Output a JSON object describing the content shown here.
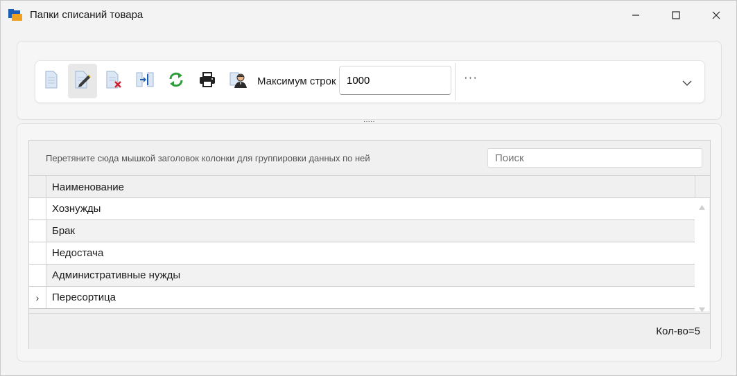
{
  "window": {
    "title": "Папки списаний товара",
    "controls": [
      "minimize",
      "maximize",
      "close"
    ]
  },
  "toolbar": {
    "buttons": [
      {
        "icon": "new-document-icon"
      },
      {
        "icon": "edit-document-icon",
        "active": true
      },
      {
        "icon": "delete-document-icon"
      },
      {
        "icon": "merge-icon"
      },
      {
        "icon": "refresh-icon"
      },
      {
        "icon": "print-icon"
      },
      {
        "icon": "user-icon"
      }
    ],
    "max_rows_label": "Максимум строк",
    "max_rows_value": "1000",
    "more_label": "···"
  },
  "grid": {
    "group_hint": "Перетяните сюда мышкой заголовок колонки для группировки данных по ней",
    "search_placeholder": "Поиск",
    "column_header": "Наименование",
    "rows": [
      {
        "name": "Хознужды"
      },
      {
        "name": "Брак"
      },
      {
        "name": "Недостача"
      },
      {
        "name": "Административные нужды"
      },
      {
        "name": "Пересортица",
        "current": true
      }
    ],
    "current_row_marker": "›",
    "count_text": "Кол-во=5"
  },
  "colors": {
    "accent_green": "#2e9e3a",
    "delete_red": "#d3202f",
    "folder_blue": "#1e5fb4",
    "folder_orange": "#f0a020"
  }
}
